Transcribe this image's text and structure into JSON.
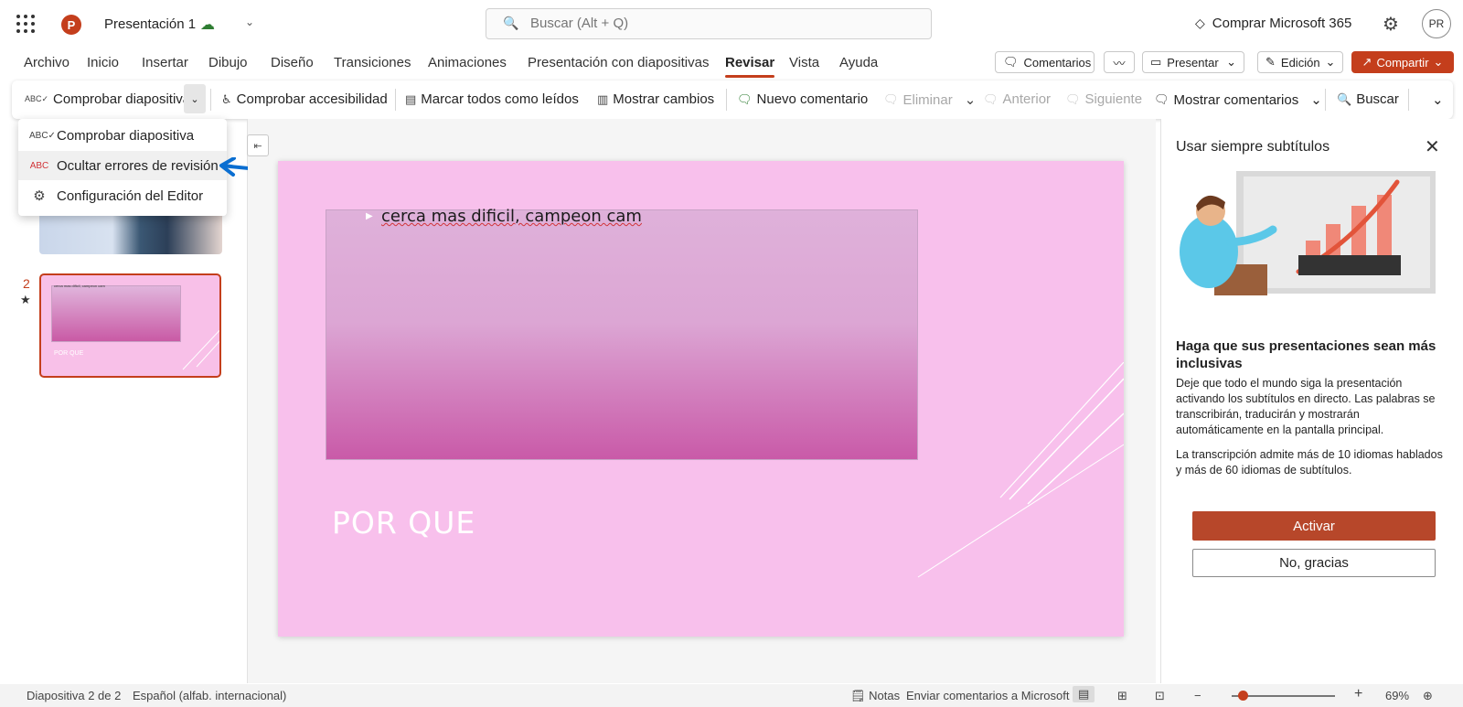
{
  "titlebar": {
    "doc_title": "Presentación 1",
    "search_placeholder": "Buscar (Alt + Q)",
    "buy_label": "Comprar Microsoft 365",
    "avatar_initials": "PR"
  },
  "tabs": [
    "Archivo",
    "Inicio",
    "Insertar",
    "Dibujo",
    "Diseño",
    "Transiciones",
    "Animaciones",
    "Presentación con diapositivas",
    "Revisar",
    "Vista",
    "Ayuda"
  ],
  "active_tab": "Revisar",
  "top_actions": {
    "comments": "Comentarios",
    "present": "Presentar",
    "editing": "Edición",
    "share": "Compartir"
  },
  "ribbon": {
    "check_slide": "Comprobar diapositiva",
    "check_accessibility": "Comprobar accesibilidad",
    "mark_all_read": "Marcar todos como leídos",
    "show_changes": "Mostrar cambios",
    "new_comment": "Nuevo comentario",
    "delete": "Eliminar",
    "previous": "Anterior",
    "next": "Siguiente",
    "show_comments": "Mostrar comentarios",
    "search": "Buscar"
  },
  "dropdown_menu": {
    "items": [
      {
        "label": "Comprobar diapositiva",
        "icon": "spellcheck-icon"
      },
      {
        "label": "Ocultar errores de revisión",
        "icon": "hide-proofing-icon"
      },
      {
        "label": "Configuración del Editor",
        "icon": "gear-icon"
      }
    ],
    "highlighted_index": 1
  },
  "slides_panel": {
    "slide2_number": "2",
    "slide2_thumb_title": "POR QUE",
    "slide2_thumb_text": "cerca mas dificil, campeon cam"
  },
  "slide": {
    "bullet_text": "cerca mas dificil, campeon cam",
    "title": "POR QUE"
  },
  "right_pane": {
    "title": "Usar siempre subtítulos",
    "heading": "Haga que sus presentaciones sean más inclusivas",
    "paragraph1": "Deje que todo el mundo siga la presentación activando los subtítulos en directo. Las palabras se transcribirán, traducirán y mostrarán automáticamente en la pantalla principal.",
    "paragraph2": "La transcripción admite más de 10 idiomas hablados y más de 60 idiomas de subtítulos.",
    "activate": "Activar",
    "no_thanks": "No, gracias"
  },
  "status": {
    "slide_counter": "Diapositiva 2 de 2",
    "language": "Español (alfab. internacional)",
    "notes": "Notas",
    "feedback": "Enviar comentarios a Microsoft",
    "zoom": "69%",
    "zoom_level": 0.69
  },
  "colors": {
    "accent": "#c43e1c",
    "slide_bg": "#f8c0ec",
    "activate_btn": "#b7472a",
    "arrow": "#0a6ed1"
  }
}
